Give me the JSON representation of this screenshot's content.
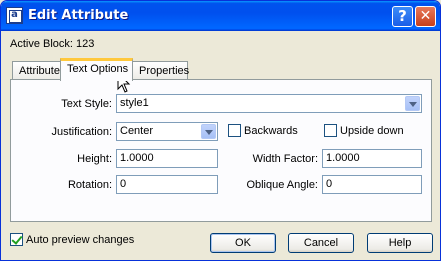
{
  "window": {
    "title": "Edit Attribute",
    "app_icon_glyph": "a"
  },
  "titlebar_buttons": {
    "help_label": "?",
    "close_label": "✕"
  },
  "active_block": "Active Block: 123",
  "tabs": [
    {
      "label": "Attribute",
      "selected": false
    },
    {
      "label": "Text Options",
      "selected": true
    },
    {
      "label": "Properties",
      "selected": false
    }
  ],
  "form": {
    "text_style_label": "Text Style:",
    "text_style_value": "style1",
    "justification_label": "Justification:",
    "justification_value": "Center",
    "backwards_label": "Backwards",
    "backwards_checked": false,
    "upside_down_label": "Upside down",
    "upside_down_checked": false,
    "height_label": "Height:",
    "height_value": "1.0000",
    "width_factor_label": "Width Factor:",
    "width_factor_value": "1.0000",
    "rotation_label": "Rotation:",
    "rotation_value": "0",
    "oblique_angle_label": "Oblique Angle:",
    "oblique_angle_value": "0"
  },
  "auto_preview": {
    "label": "Auto preview changes",
    "checked": true
  },
  "buttons": {
    "ok": "OK",
    "cancel": "Cancel",
    "help": "Help"
  },
  "colors": {
    "title_bar": "#0054e3",
    "dialog_bg": "#ece9d8",
    "tab_hover": "#ffc83c"
  }
}
